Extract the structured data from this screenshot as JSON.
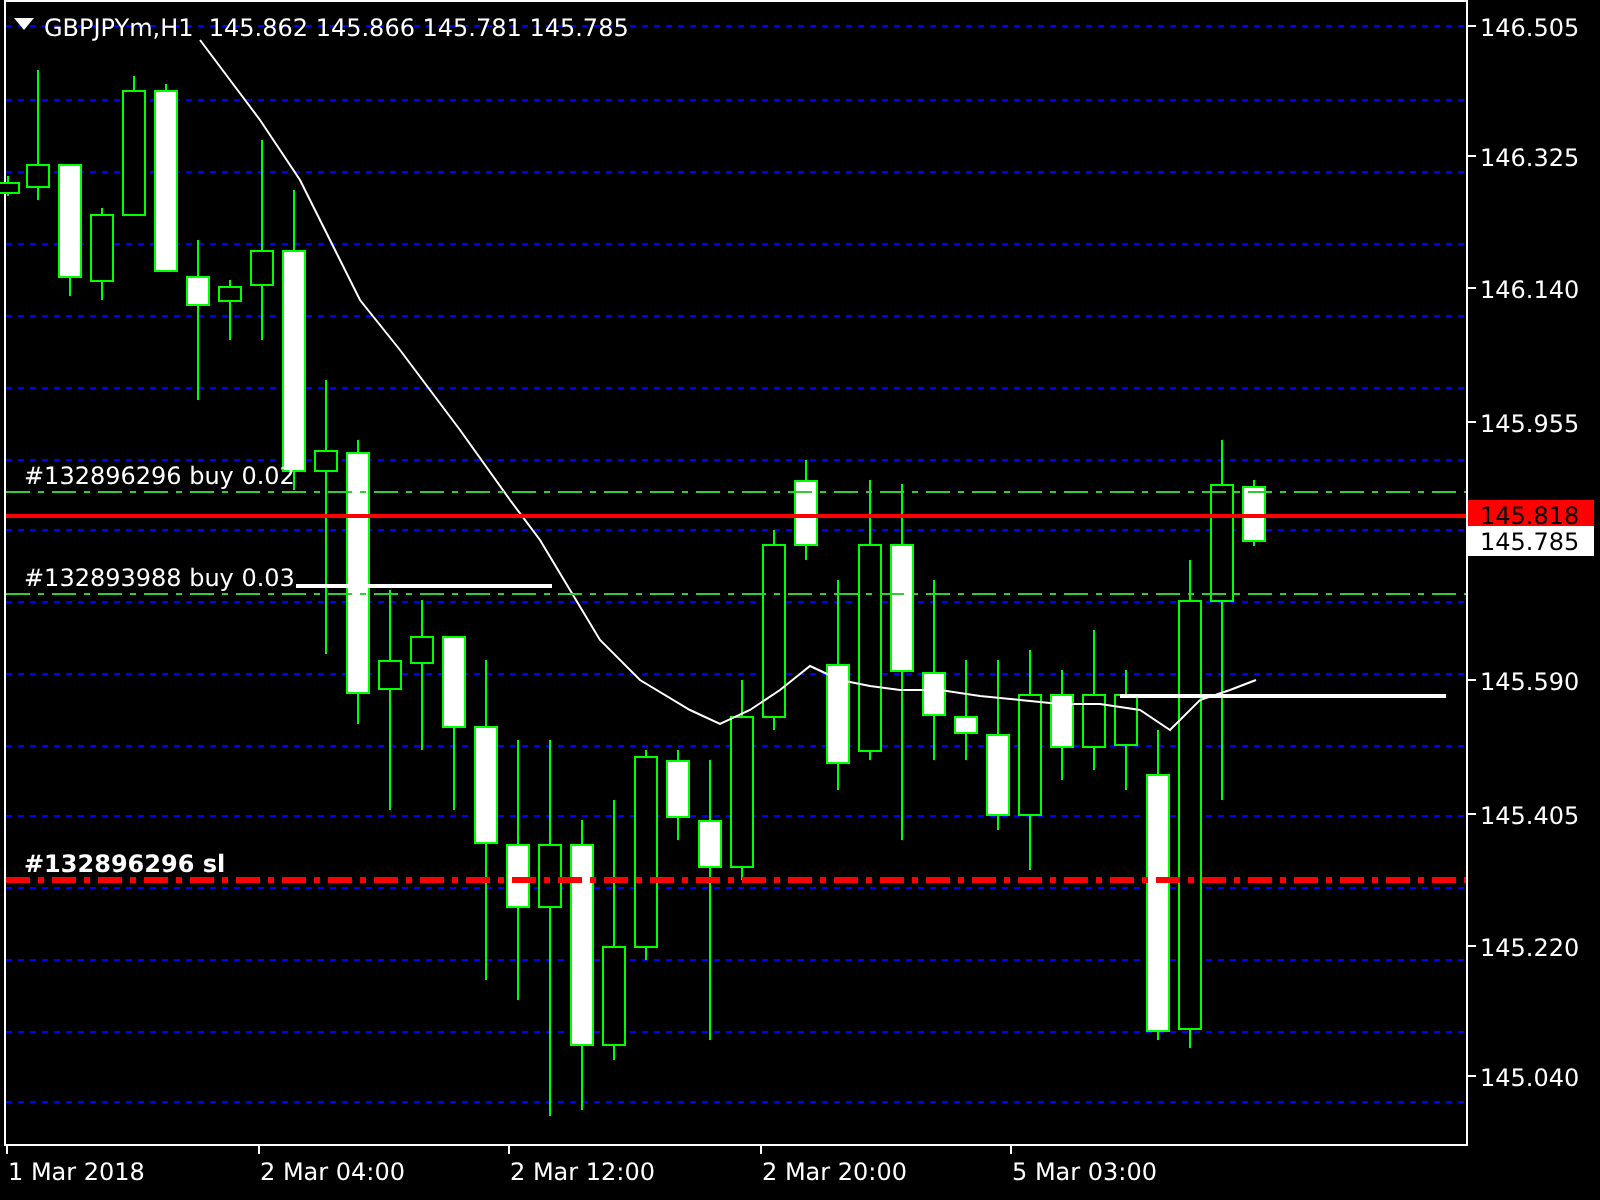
{
  "chart": {
    "title": "GBPJPYm,H1",
    "ohlc": [
      "145.862",
      "145.866",
      "145.781",
      "145.785"
    ]
  },
  "orders": [
    {
      "label": "#132896296 buy 0.02",
      "kind": "entry"
    },
    {
      "label": "#132893988 buy 0.03",
      "kind": "entry"
    },
    {
      "label": "#132896296 sl",
      "kind": "stop_loss"
    }
  ],
  "price_axis": {
    "labels": [
      "146.505",
      "146.325",
      "146.140",
      "145.955",
      "145.590",
      "145.405",
      "145.220",
      "145.040"
    ]
  },
  "price_tags": [
    {
      "value": "145.818",
      "kind": "ask"
    },
    {
      "value": "145.785",
      "kind": "bid"
    }
  ],
  "time_axis": {
    "labels": [
      "1 Mar 2018",
      "2 Mar 04:00",
      "2 Mar 12:00",
      "2 Mar 20:00",
      "5 Mar 03:00"
    ]
  }
}
